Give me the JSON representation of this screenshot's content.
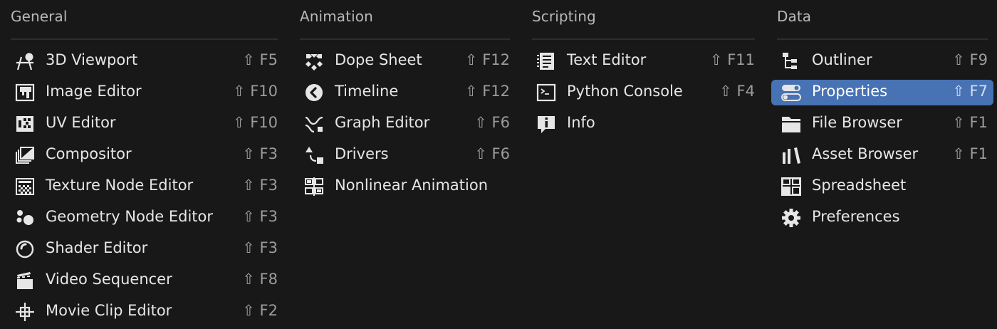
{
  "columns": [
    {
      "title": "General",
      "items": [
        {
          "label": "3D Viewport",
          "shortcut": "⇧ F5",
          "icon": "viewport-3d-icon"
        },
        {
          "label": "Image Editor",
          "shortcut": "⇧ F10",
          "icon": "image-editor-icon"
        },
        {
          "label": "UV Editor",
          "shortcut": "⇧ F10",
          "icon": "uv-editor-icon"
        },
        {
          "label": "Compositor",
          "shortcut": "⇧ F3",
          "icon": "compositor-icon"
        },
        {
          "label": "Texture Node Editor",
          "shortcut": "⇧ F3",
          "icon": "texture-node-icon"
        },
        {
          "label": "Geometry Node Editor",
          "shortcut": "⇧ F3",
          "icon": "geometry-node-icon"
        },
        {
          "label": "Shader Editor",
          "shortcut": "⇧ F3",
          "icon": "shader-editor-icon"
        },
        {
          "label": "Video Sequencer",
          "shortcut": "⇧ F8",
          "icon": "video-sequencer-icon"
        },
        {
          "label": "Movie Clip Editor",
          "shortcut": "⇧ F2",
          "icon": "movie-clip-icon"
        }
      ]
    },
    {
      "title": "Animation",
      "items": [
        {
          "label": "Dope Sheet",
          "shortcut": "⇧ F12",
          "icon": "dope-sheet-icon"
        },
        {
          "label": "Timeline",
          "shortcut": "⇧ F12",
          "icon": "timeline-icon"
        },
        {
          "label": "Graph Editor",
          "shortcut": "⇧ F6",
          "icon": "graph-editor-icon"
        },
        {
          "label": "Drivers",
          "shortcut": "⇧ F6",
          "icon": "drivers-icon"
        },
        {
          "label": "Nonlinear Animation",
          "shortcut": "",
          "icon": "nla-icon"
        }
      ]
    },
    {
      "title": "Scripting",
      "items": [
        {
          "label": "Text Editor",
          "shortcut": "⇧ F11",
          "icon": "text-editor-icon"
        },
        {
          "label": "Python Console",
          "shortcut": "⇧ F4",
          "icon": "python-console-icon"
        },
        {
          "label": "Info",
          "shortcut": "",
          "icon": "info-icon"
        }
      ]
    },
    {
      "title": "Data",
      "items": [
        {
          "label": "Outliner",
          "shortcut": "⇧ F9",
          "icon": "outliner-icon"
        },
        {
          "label": "Properties",
          "shortcut": "⇧ F7",
          "icon": "properties-icon",
          "active": true
        },
        {
          "label": "File Browser",
          "shortcut": "⇧ F1",
          "icon": "file-browser-icon"
        },
        {
          "label": "Asset Browser",
          "shortcut": "⇧ F1",
          "icon": "asset-browser-icon"
        },
        {
          "label": "Spreadsheet",
          "shortcut": "",
          "icon": "spreadsheet-icon"
        },
        {
          "label": "Preferences",
          "shortcut": "",
          "icon": "gear-icon"
        }
      ]
    }
  ],
  "colors": {
    "background": "#181818",
    "highlight": "#4772b3",
    "text": "#e6e6e6",
    "shortcut": "#9c9c9c",
    "header": "#b9b9b9"
  }
}
